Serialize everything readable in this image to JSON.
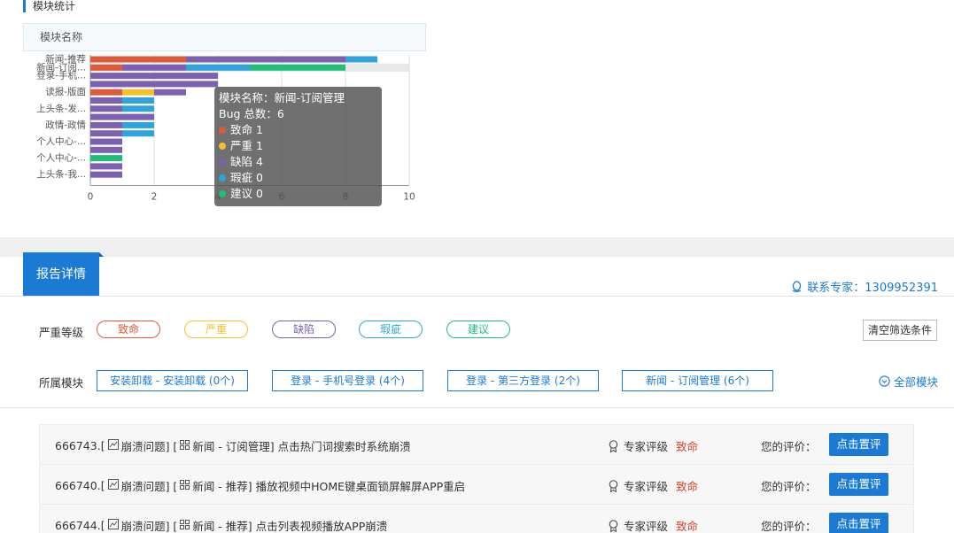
{
  "section_title": "模块统计",
  "legend_header": "模块名称",
  "chart_data": {
    "type": "bar",
    "orientation": "horizontal",
    "stacked": true,
    "categories": [
      "新闻-推荐",
      "新闻-订阅...",
      "登录-手机...",
      "",
      "读报-版面",
      "",
      "上头条-发...",
      "",
      "政情-政情",
      "",
      "个人中心-...",
      "",
      "个人中心-...",
      "",
      "上头条-我..."
    ],
    "series": [
      {
        "name": "致命",
        "color": "#dd5a3a",
        "values": [
          3,
          1,
          0,
          0,
          1,
          0,
          0,
          0,
          0,
          0,
          0,
          0,
          0,
          0,
          0
        ]
      },
      {
        "name": "严重",
        "color": "#f2c12e",
        "values": [
          0,
          0,
          0,
          0,
          1,
          0,
          0,
          0,
          0,
          0,
          0,
          0,
          0,
          0,
          0
        ]
      },
      {
        "name": "缺陷",
        "color": "#7b61b0",
        "values": [
          5,
          2,
          4,
          4,
          1,
          1,
          1,
          2,
          1,
          1,
          1,
          1,
          0,
          1,
          1
        ]
      },
      {
        "name": "瑕疵",
        "color": "#2ea3dd",
        "values": [
          1,
          2,
          0,
          0,
          0,
          1,
          1,
          0,
          1,
          1,
          0,
          0,
          0,
          0,
          0
        ]
      },
      {
        "name": "建议",
        "color": "#1fbf7a",
        "values": [
          0,
          3,
          0,
          0,
          0,
          0,
          0,
          0,
          0,
          0,
          0,
          0,
          1,
          0,
          0
        ]
      }
    ],
    "xlim": [
      0,
      10
    ],
    "xticks": [
      "0",
      "2",
      "4",
      "6",
      "8",
      "10"
    ],
    "grid": true
  },
  "tooltip": {
    "module_line": "模块名称：新闻-订阅管理",
    "total_line": "Bug 总数：6",
    "rows": [
      {
        "label": "致命 1",
        "color": "#dd5a3a"
      },
      {
        "label": "严重 1",
        "color": "#f2c12e"
      },
      {
        "label": "缺陷 4",
        "color": "#7b61b0"
      },
      {
        "label": "瑕疵 0",
        "color": "#2ea3dd"
      },
      {
        "label": "建议 0",
        "color": "#1fbf7a"
      }
    ]
  },
  "tab_label": "报告详情",
  "contact": "联系专家：1309952391",
  "severity_label": "严重等级",
  "severity_pills": [
    {
      "label": "致命",
      "color": "#dd5a3a"
    },
    {
      "label": "严重",
      "color": "#f2c12e"
    },
    {
      "label": "缺陷",
      "color": "#7b61b0"
    },
    {
      "label": "瑕疵",
      "color": "#2ea3dd"
    },
    {
      "label": "建议",
      "color": "#1fbf7a"
    }
  ],
  "clear_filters": "清空筛选条件",
  "module_label": "所属模块",
  "modules": [
    "安装卸载 - 安装卸载 (0个)",
    "登录 - 手机号登录 (4个)",
    "登录 - 第三方登录 (2个)",
    "新闻 - 订阅管理 (6个)"
  ],
  "all_modules": "全部模块",
  "items": [
    {
      "id": "666743.[",
      "type": "崩溃问题] [",
      "module": "新闻 - 订阅管理] 点击热门词搜索时系统崩溃",
      "rank_label": "专家评级",
      "severity": "致命",
      "eval_label": "您的评价：",
      "eval_button": "点击置评"
    },
    {
      "id": "666740.[",
      "type": "崩溃问题] [",
      "module": "新闻 - 推荐] 播放视频中HOME键桌面锁屏解屏APP重启",
      "rank_label": "专家评级",
      "severity": "致命",
      "eval_label": "您的评价：",
      "eval_button": "点击置评"
    },
    {
      "id": "666744.[",
      "type": "崩溃问题] [",
      "module": "新闻 - 推荐] 点击列表视频播放APP崩溃",
      "rank_label": "专家评级",
      "severity": "致命",
      "eval_label": "您的评价：",
      "eval_button": "点击置评"
    }
  ]
}
